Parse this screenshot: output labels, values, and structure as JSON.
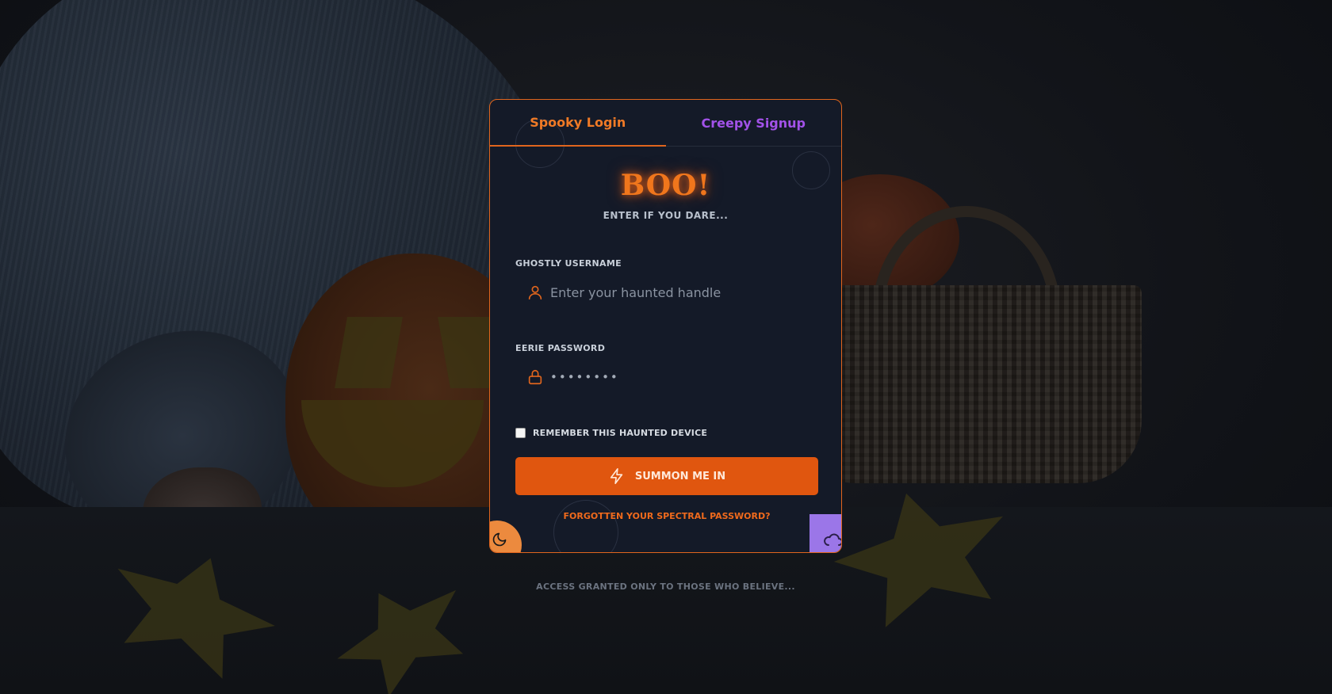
{
  "tabs": {
    "login": "Spooky Login",
    "signup": "Creepy Signup"
  },
  "header": {
    "title": "BOO!",
    "subtitle": "Enter if you dare..."
  },
  "form": {
    "username": {
      "label": "Ghostly Username",
      "placeholder": "Enter your haunted handle",
      "icon": "user-icon"
    },
    "password": {
      "label": "Eerie Password",
      "value": "••••••••",
      "icon": "lock-icon"
    },
    "remember": {
      "label": "Remember this haunted device",
      "checked": false
    },
    "submit": {
      "label": "Summon me in",
      "icon": "bolt-icon"
    },
    "forgot_link": "Forgotten your spectral password?"
  },
  "corner_buttons": {
    "left_icon": "moon-icon",
    "right_icon": "cloud-icon"
  },
  "footer": {
    "text": "Access granted only to those who believe..."
  },
  "colors": {
    "accent_orange": "#e0651d",
    "accent_purple": "#a252e8",
    "card_bg": "#141a28"
  }
}
